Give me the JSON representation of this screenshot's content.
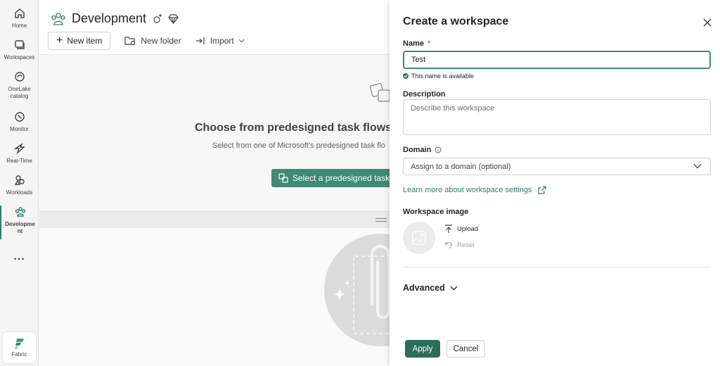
{
  "rail": {
    "items": [
      {
        "label": "Home",
        "icon": "home-icon"
      },
      {
        "label": "Workspaces",
        "icon": "workspaces-icon"
      },
      {
        "label": "OneLake catalog",
        "icon": "onelake-icon"
      },
      {
        "label": "Monitor",
        "icon": "monitor-icon"
      },
      {
        "label": "Real-Time",
        "icon": "real-time-icon"
      },
      {
        "label": "Workloads",
        "icon": "workloads-icon"
      },
      {
        "label": "Developme nt",
        "icon": "development-icon",
        "active": true
      }
    ],
    "more": "...",
    "fabric_label": "Fabric"
  },
  "workspace": {
    "title": "Development",
    "toolbar": {
      "new_item": "New item",
      "new_folder": "New folder",
      "import": "Import"
    },
    "taskflow": {
      "title": "Choose from predesigned task flows c",
      "subtitle": "Select from one of Microsoft's predesigned task flo",
      "button": "Select a predesigned task f"
    }
  },
  "panel": {
    "title": "Create a workspace",
    "name_label": "Name",
    "required_mark": "*",
    "name_value": "Test",
    "name_status": "This name is available",
    "description_label": "Description",
    "description_placeholder": "Describe this workspace",
    "domain_label": "Domain",
    "domain_placeholder": "Assign to a domain (optional)",
    "learn_more": "Learn more about workspace settings",
    "image_label": "Workspace image",
    "upload": "Upload",
    "reset": "Reset",
    "advanced": "Advanced",
    "apply": "Apply",
    "cancel": "Cancel"
  },
  "colors": {
    "accent": "#3e8a74",
    "primary_button": "#2d6b5a",
    "link": "#2e7d6b",
    "available": "#2e7d32",
    "required": "#c4314b"
  }
}
